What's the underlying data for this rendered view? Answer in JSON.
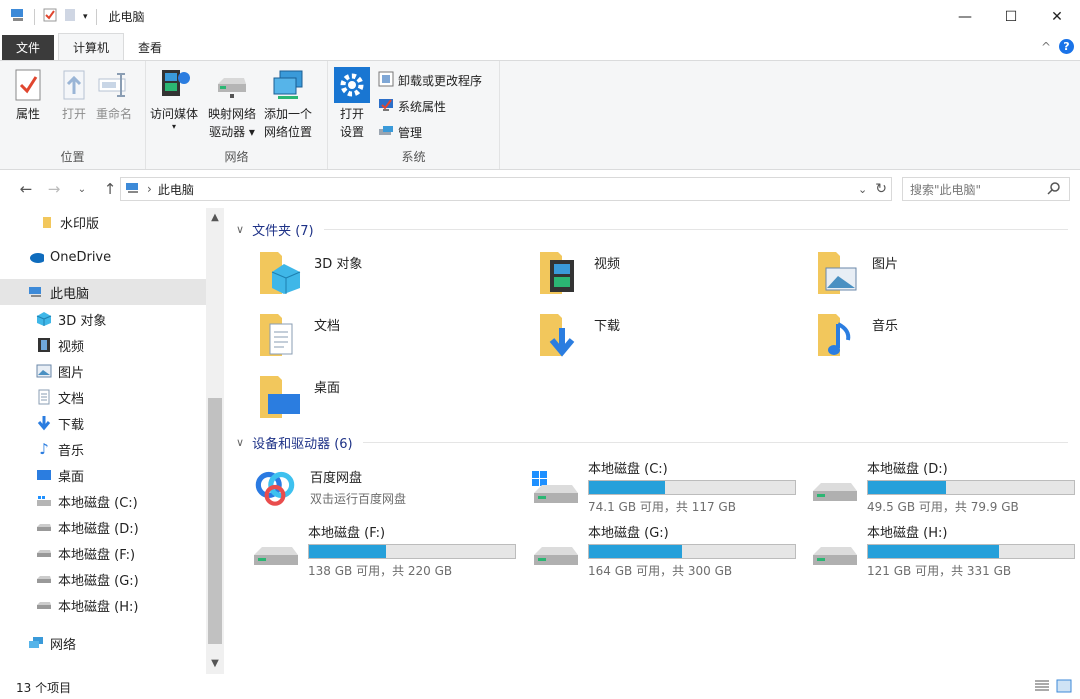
{
  "window": {
    "title": "此电脑",
    "minimize": "—",
    "maximize": "☐",
    "close": "✕"
  },
  "tabs": {
    "file": "文件",
    "computer": "计算机",
    "view": "查看",
    "collapse": "^",
    "help": "?"
  },
  "ribbon": {
    "location": {
      "label": "位置",
      "properties": "属性",
      "open": "打开",
      "rename": "重命名"
    },
    "network": {
      "label": "网络",
      "media_l1": "访问媒体",
      "map_l1": "映射网络",
      "map_l2": "驱动器",
      "add_l1": "添加一个",
      "add_l2": "网络位置"
    },
    "system": {
      "label": "系统",
      "settings_l1": "打开",
      "settings_l2": "设置",
      "uninstall": "卸载或更改程序",
      "sysprops": "系统属性",
      "manage": "管理"
    }
  },
  "address": {
    "path": "此电脑",
    "search_placeholder": "搜索\"此电脑\""
  },
  "nav": {
    "watermark": "水印版",
    "onedrive": "OneDrive",
    "thispc": "此电脑",
    "items": [
      "3D 对象",
      "视频",
      "图片",
      "文档",
      "下载",
      "音乐",
      "桌面",
      "本地磁盘 (C:)",
      "本地磁盘 (D:)",
      "本地磁盘 (F:)",
      "本地磁盘 (G:)",
      "本地磁盘 (H:)"
    ],
    "network": "网络"
  },
  "folders": {
    "header": "文件夹 (7)",
    "items": [
      "3D 对象",
      "视频",
      "图片",
      "文档",
      "下载",
      "音乐",
      "桌面"
    ]
  },
  "devices": {
    "header": "设备和驱动器 (6)",
    "baidu": {
      "name": "百度网盘",
      "sub": "双击运行百度网盘"
    },
    "drives": [
      {
        "name": "本地磁盘 (C:)",
        "sub": "74.1 GB 可用，共 117 GB",
        "used": 0.367
      },
      {
        "name": "本地磁盘 (D:)",
        "sub": "49.5 GB 可用，共 79.9 GB",
        "used": 0.38
      },
      {
        "name": "本地磁盘 (F:)",
        "sub": "138 GB 可用，共 220 GB",
        "used": 0.373
      },
      {
        "name": "本地磁盘 (G:)",
        "sub": "164 GB 可用，共 300 GB",
        "used": 0.453
      },
      {
        "name": "本地磁盘 (H:)",
        "sub": "121 GB 可用，共 331 GB",
        "used": 0.634
      }
    ]
  },
  "status": {
    "count": "13 个项目"
  },
  "colors": {
    "accent": "#26a0da",
    "section_header": "#1e3287",
    "folder": "#f2c75c"
  }
}
